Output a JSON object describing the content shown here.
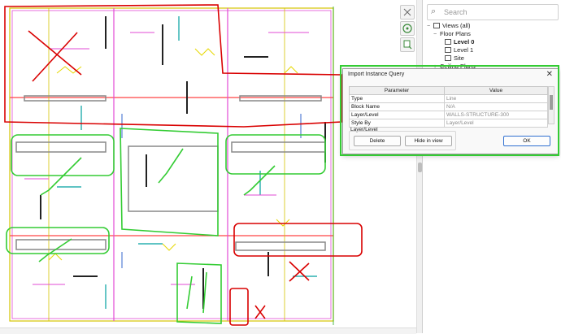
{
  "browser": {
    "search_placeholder": "Search",
    "items": [
      {
        "label": "Views (all)",
        "level": 0,
        "toggle": "−"
      },
      {
        "label": "Floor Plans",
        "level": 1,
        "toggle": "−"
      },
      {
        "label": "Level 0",
        "level": 2,
        "bold": true
      },
      {
        "label": "Level 1",
        "level": 2
      },
      {
        "label": "Site",
        "level": 2
      },
      {
        "label": "Ceiling Plans",
        "level": 1,
        "toggle": "+"
      }
    ]
  },
  "dialog": {
    "title": "Import Instance Query",
    "close_glyph": "✕",
    "columns": [
      "Parameter",
      "Value"
    ],
    "rows": [
      {
        "param": "Type",
        "value": "Line"
      },
      {
        "param": "Block Name",
        "value": "N/A"
      },
      {
        "param": "Layer/Level",
        "value": "WALLS-STRUCTURE-300"
      },
      {
        "param": "Style By",
        "value": "Layer/Level"
      }
    ],
    "group_label": "Layer/Level",
    "delete_label": "Delete",
    "hide_label": "Hide in view",
    "ok_label": "OK"
  },
  "colors": {
    "green_markup": "#33cc33",
    "red_markup": "#d90000",
    "ok_border": "#2f6fd0"
  },
  "icons": [
    "search-icon",
    "nav-steering-wheel-icon",
    "zoom-icon",
    "close-icon",
    "view-icon"
  ]
}
